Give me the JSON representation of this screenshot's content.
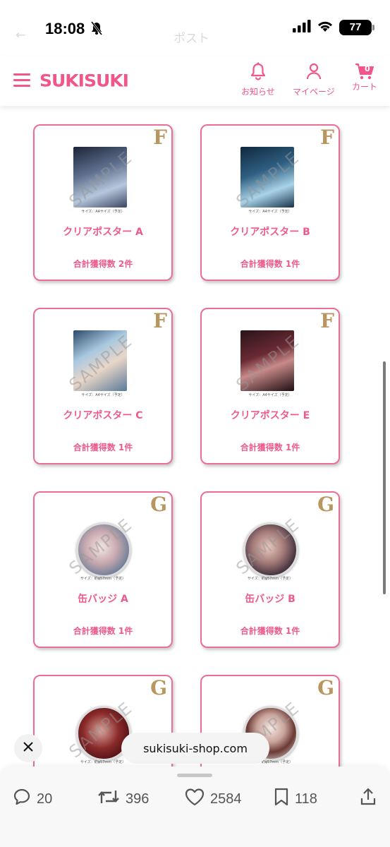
{
  "status_bar": {
    "time": "18:08",
    "battery": "77"
  },
  "background_overlay": {
    "title": "ポスト"
  },
  "header": {
    "logo": "SUKISUKI",
    "nav": [
      {
        "label": "お知らせ",
        "icon": "bell-icon"
      },
      {
        "label": "マイページ",
        "icon": "person-icon"
      },
      {
        "label": "カート",
        "icon": "cart-icon",
        "count": "0"
      }
    ]
  },
  "products": [
    {
      "rank": "F",
      "name": "クリアポスター A",
      "count": "合計獲得数 2件",
      "type": "poster",
      "spec": "サイズ：A4サイズ（予定）",
      "watermark": "SAMPLE"
    },
    {
      "rank": "F",
      "name": "クリアポスター B",
      "count": "合計獲得数 1件",
      "type": "poster",
      "spec": "サイズ：A4サイズ（予定）",
      "watermark": "SAMPLE"
    },
    {
      "rank": "F",
      "name": "クリアポスター C",
      "count": "合計獲得数 1件",
      "type": "poster",
      "spec": "サイズ：A4サイズ（予定）",
      "watermark": "SAMPLE"
    },
    {
      "rank": "F",
      "name": "クリアポスター E",
      "count": "合計獲得数 1件",
      "type": "poster",
      "spec": "サイズ：A4サイズ（予定）",
      "watermark": "SAMPLE"
    },
    {
      "rank": "G",
      "name": "缶バッジ A",
      "count": "合計獲得数 1件",
      "type": "badge",
      "spec": "サイズ：約φ57mm（予定）",
      "watermark": "SAMPLE"
    },
    {
      "rank": "G",
      "name": "缶バッジ B",
      "count": "合計獲得数 1件",
      "type": "badge",
      "spec": "サイズ：約φ57mm（予定）",
      "watermark": "SAMPLE"
    },
    {
      "rank": "G",
      "name": "",
      "count": "",
      "type": "badge",
      "spec": "サイズ：約φ57mm（予定）",
      "watermark": "SAMPLE"
    },
    {
      "rank": "G",
      "name": "",
      "count": "",
      "type": "badge",
      "spec": "サイズ：約φ57mm（予定）",
      "watermark": "SAMPLE"
    }
  ],
  "link_overlay": {
    "url": "sukisuki-shop.com"
  },
  "actions": {
    "replies": "20",
    "reposts": "396",
    "likes": "2584",
    "bookmarks": "118"
  },
  "colors": {
    "accent": "#f0568c",
    "rank_gold": "#b89660",
    "card_border": "#ec6d96"
  }
}
